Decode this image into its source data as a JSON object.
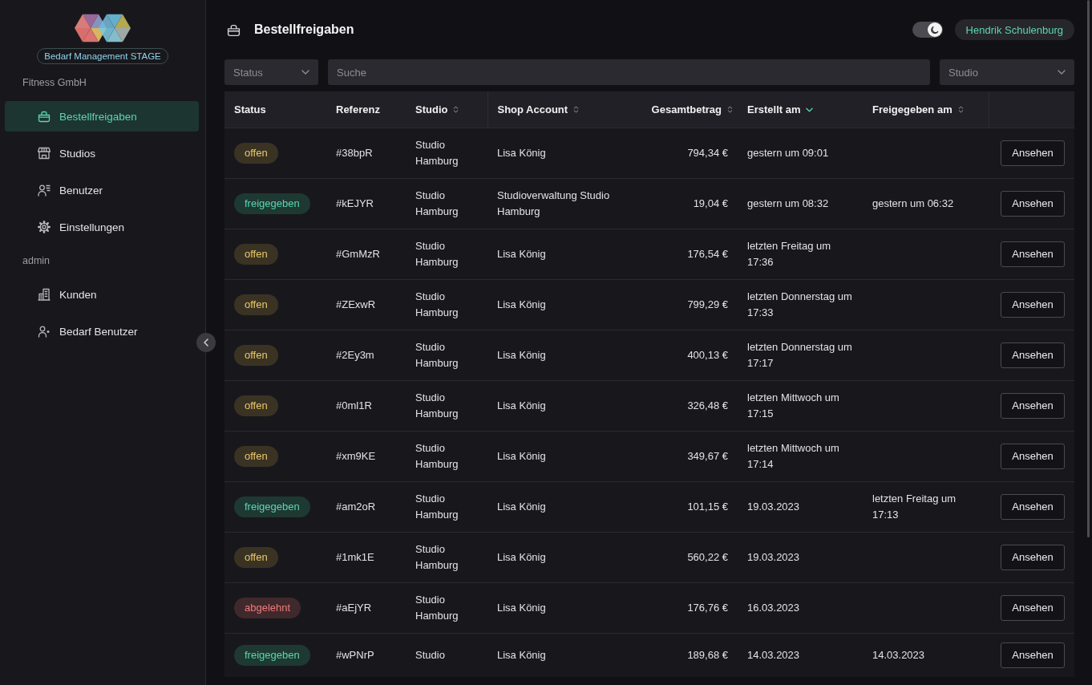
{
  "sidebar": {
    "app_badge": "Bedarf Management STAGE",
    "sections": [
      {
        "title": "Fitness GmbH",
        "items": [
          {
            "label": "Bestellfreigaben",
            "selected": true
          },
          {
            "label": "Studios",
            "selected": false
          },
          {
            "label": "Benutzer",
            "selected": false
          },
          {
            "label": "Einstellungen",
            "selected": false
          }
        ]
      },
      {
        "title": "admin",
        "items": [
          {
            "label": "Kunden",
            "selected": false
          },
          {
            "label": "Bedarf Benutzer",
            "selected": false
          }
        ]
      }
    ]
  },
  "header": {
    "title": "Bestellfreigaben",
    "theme_toggle": {
      "on": true
    },
    "user": "Hendrik Schulenburg"
  },
  "filters": {
    "status": {
      "placeholder": "Status"
    },
    "search": {
      "placeholder": "Suche"
    },
    "studio": {
      "placeholder": "Studio"
    }
  },
  "table": {
    "columns": [
      {
        "label": "Status",
        "sortable": false,
        "sorted": false
      },
      {
        "label": "Referenz",
        "sortable": false,
        "sorted": false
      },
      {
        "label": "Studio",
        "sortable": true,
        "sorted": false
      },
      {
        "label": "Shop Account",
        "sortable": true,
        "sorted": false
      },
      {
        "label": "Gesamtbetrag",
        "sortable": true,
        "sorted": false
      },
      {
        "label": "Erstellt am",
        "sortable": true,
        "sorted": true
      },
      {
        "label": "Freigegeben am",
        "sortable": true,
        "sorted": false
      }
    ],
    "rows": [
      {
        "status": {
          "label": "offen",
          "kind": "open"
        },
        "reference": "#38bpR",
        "studio": "Studio Hamburg",
        "shop_account": "Lisa König",
        "total": "794,34 €",
        "created": "gestern um 09:01",
        "action": "Ansehen"
      },
      {
        "status": {
          "label": "freigegeben",
          "kind": "approved"
        },
        "reference": "#kEJYR",
        "studio": "Studio Hamburg",
        "shop_account": "Studioverwaltung Studio Hamburg",
        "total": "19,04 €",
        "created": "gestern um 08:32",
        "released": "gestern um 06:32",
        "action": "Ansehen"
      },
      {
        "status": {
          "label": "offen",
          "kind": "open"
        },
        "reference": "#GmMzR",
        "studio": "Studio Hamburg",
        "shop_account": "Lisa König",
        "total": "176,54 €",
        "created": "letzten Freitag um 17:36",
        "action": "Ansehen"
      },
      {
        "status": {
          "label": "offen",
          "kind": "open"
        },
        "reference": "#ZExwR",
        "studio": "Studio Hamburg",
        "shop_account": "Lisa König",
        "total": "799,29 €",
        "created": "letzten Donnerstag um 17:33",
        "action": "Ansehen"
      },
      {
        "status": {
          "label": "offen",
          "kind": "open"
        },
        "reference": "#2Ey3m",
        "studio": "Studio Hamburg",
        "shop_account": "Lisa König",
        "total": "400,13 €",
        "created": "letzten Donnerstag um 17:17",
        "action": "Ansehen"
      },
      {
        "status": {
          "label": "offen",
          "kind": "open"
        },
        "reference": "#0ml1R",
        "studio": "Studio Hamburg",
        "shop_account": "Lisa König",
        "total": "326,48 €",
        "created": "letzten Mittwoch um 17:15",
        "action": "Ansehen"
      },
      {
        "status": {
          "label": "offen",
          "kind": "open"
        },
        "reference": "#xm9KE",
        "studio": "Studio Hamburg",
        "shop_account": "Lisa König",
        "total": "349,67 €",
        "created": "letzten Mittwoch um 17:14",
        "action": "Ansehen"
      },
      {
        "status": {
          "label": "freigegeben",
          "kind": "approved"
        },
        "reference": "#am2oR",
        "studio": "Studio Hamburg",
        "shop_account": "Lisa König",
        "total": "101,15 €",
        "created": "19.03.2023",
        "released": "letzten Freitag um 17:13",
        "action": "Ansehen"
      },
      {
        "status": {
          "label": "offen",
          "kind": "open"
        },
        "reference": "#1mk1E",
        "studio": "Studio Hamburg",
        "shop_account": "Lisa König",
        "total": "560,22 €",
        "created": "19.03.2023",
        "action": "Ansehen"
      },
      {
        "status": {
          "label": "abgelehnt",
          "kind": "rejected"
        },
        "reference": "#aEjYR",
        "studio": "Studio Hamburg",
        "shop_account": "Lisa König",
        "total": "176,76 €",
        "created": "16.03.2023",
        "action": "Ansehen"
      },
      {
        "status": {
          "label": "freigegeben",
          "kind": "approved"
        },
        "reference": "#wPNrP",
        "studio": "Studio",
        "shop_account": "Lisa König",
        "total": "189,68 €",
        "created": "14.03.2023",
        "released": "14.03.2023",
        "action": "Ansehen"
      }
    ]
  }
}
